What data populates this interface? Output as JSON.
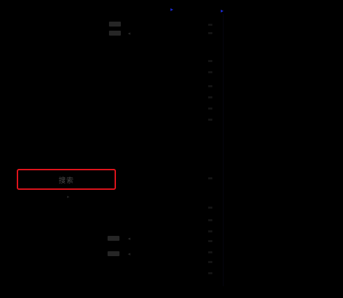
{
  "header": {
    "marker_left_icon": "small-triangle-icon",
    "marker_right_icon": "small-triangle-icon",
    "marker_glyph": "▸"
  },
  "settings_top": {
    "row1_label": "...",
    "row1_toggle_state": "off",
    "row2_label": "...",
    "row2_toggle_state": "off"
  },
  "main_button": {
    "label": "搜索"
  },
  "side_hint": {
    "text": "▸"
  },
  "settings_bottom": {
    "row1_toggle_state": "off",
    "row2_toggle_state": "off",
    "arrow": "◂"
  },
  "colors": {
    "highlight_border": "#e1141c",
    "marker": "#1c2bd6",
    "background": "#000000"
  }
}
